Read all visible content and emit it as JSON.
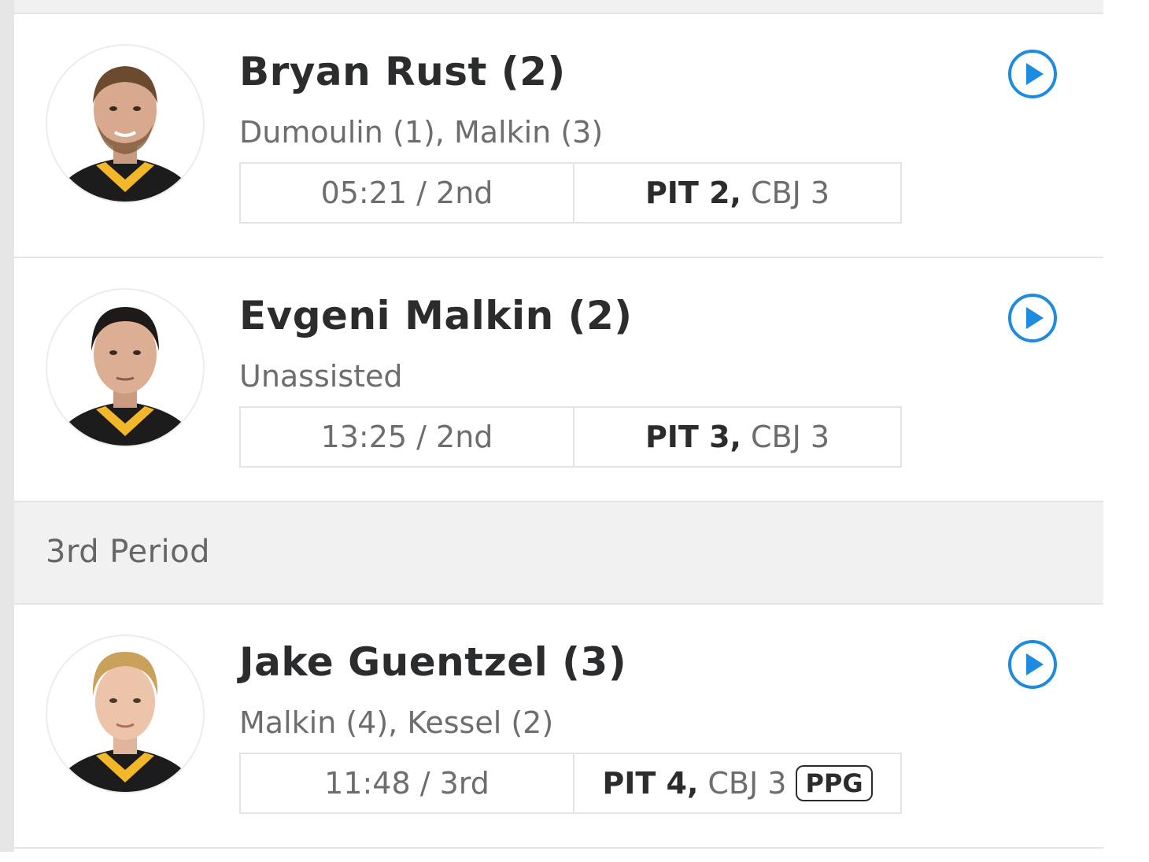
{
  "goals": [
    {
      "scorer": "Bryan Rust (2)",
      "assists": "Dumoulin (1), Malkin (3)",
      "time": "05:21 / 2nd",
      "score_home": "PIT 2",
      "score_away": "CBJ 3",
      "badge": ""
    },
    {
      "scorer": "Evgeni Malkin (2)",
      "assists": "Unassisted",
      "time": "13:25 / 2nd",
      "score_home": "PIT 3",
      "score_away": "CBJ 3",
      "badge": ""
    },
    {
      "scorer": "Jake Guentzel (3)",
      "assists": "Malkin (4), Kessel (2)",
      "time": "11:48 / 3rd",
      "score_home": "PIT 4",
      "score_away": "CBJ 3",
      "badge": "PPG"
    }
  ],
  "periods": {
    "third": "3rd Period"
  },
  "icons": {
    "play": "play-icon",
    "avatar": "player-headshot"
  },
  "colors": {
    "accent": "#1d8ce0",
    "jersey_black": "#1c1c1c",
    "jersey_gold": "#f2b82a"
  }
}
